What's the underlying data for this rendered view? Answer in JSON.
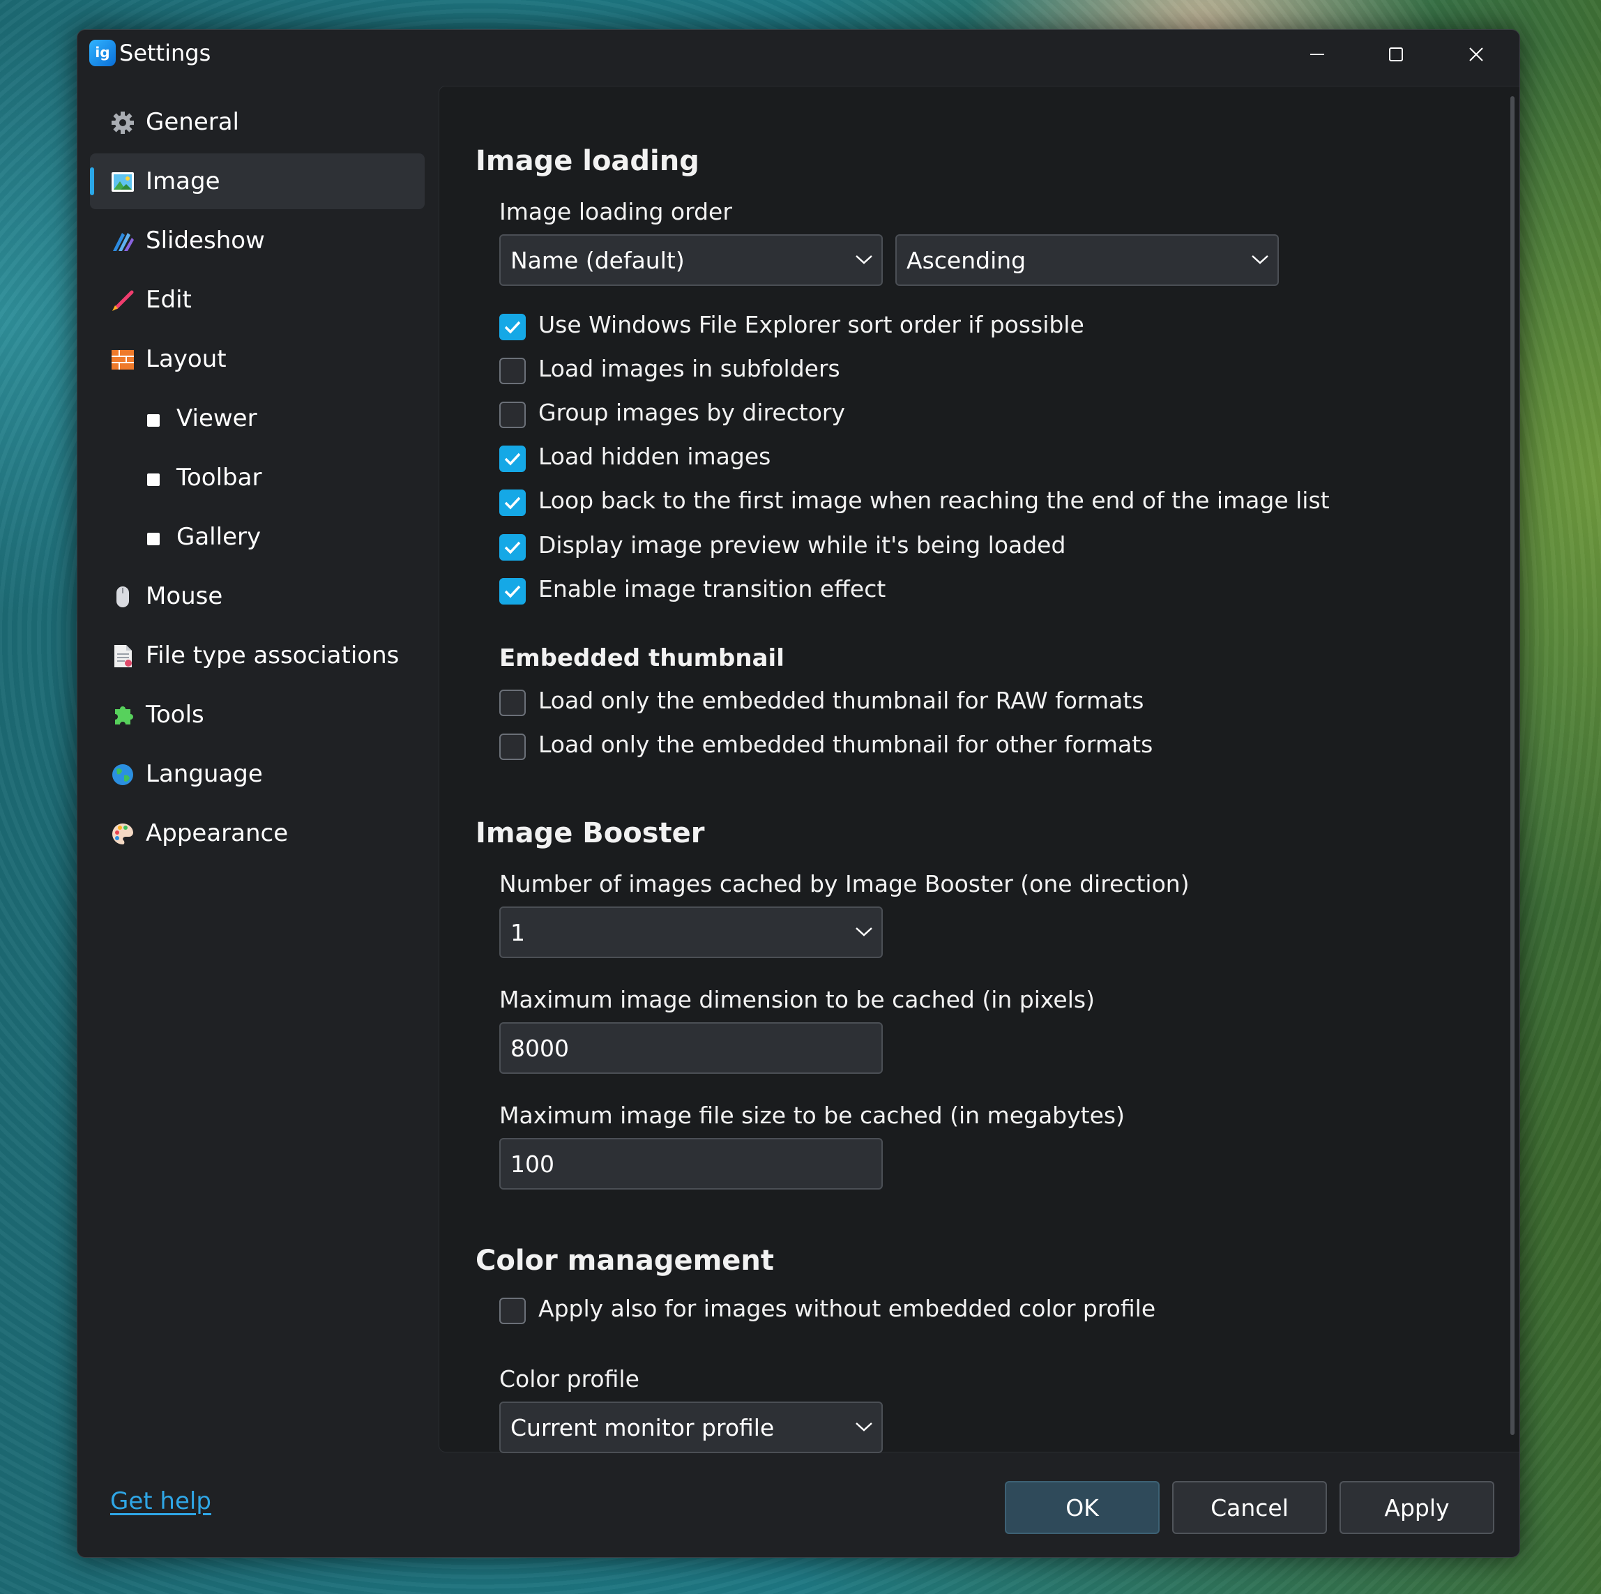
{
  "window": {
    "title": "Settings",
    "app_icon_text": "ig",
    "controls": {
      "minimize": "minimize-icon",
      "maximize": "maximize-icon",
      "close": "close-icon"
    }
  },
  "sidebar": {
    "items": [
      {
        "label": "General",
        "icon": "gear-icon"
      },
      {
        "label": "Image",
        "icon": "image-icon",
        "selected": true
      },
      {
        "label": "Slideshow",
        "icon": "slideshow-icon"
      },
      {
        "label": "Edit",
        "icon": "brush-icon"
      },
      {
        "label": "Layout",
        "icon": "layout-icon"
      },
      {
        "label": "Viewer",
        "sub": true
      },
      {
        "label": "Toolbar",
        "sub": true
      },
      {
        "label": "Gallery",
        "sub": true
      },
      {
        "label": "Mouse",
        "icon": "mouse-icon"
      },
      {
        "label": "File type associations",
        "icon": "file-icon"
      },
      {
        "label": "Tools",
        "icon": "puzzle-icon"
      },
      {
        "label": "Language",
        "icon": "globe-icon"
      },
      {
        "label": "Appearance",
        "icon": "palette-icon"
      }
    ],
    "help_link": "Get help"
  },
  "image_loading": {
    "heading": "Image loading",
    "order_label": "Image loading order",
    "order_value": "Name (default)",
    "direction_value": "Ascending",
    "options": [
      {
        "label": "Use Windows File Explorer sort order if possible",
        "checked": true
      },
      {
        "label": "Load images in subfolders",
        "checked": false
      },
      {
        "label": "Group images by directory",
        "checked": false
      },
      {
        "label": "Load hidden images",
        "checked": true
      },
      {
        "label": "Loop back to the first image when reaching the end of the image list",
        "checked": true
      },
      {
        "label": "Display image preview while it's being loaded",
        "checked": true
      },
      {
        "label": "Enable image transition effect",
        "checked": true
      }
    ]
  },
  "embedded_thumbnail": {
    "heading": "Embedded thumbnail",
    "options": [
      {
        "label": "Load only the embedded thumbnail for RAW formats",
        "checked": false
      },
      {
        "label": "Load only the embedded thumbnail for other formats",
        "checked": false
      }
    ]
  },
  "image_booster": {
    "heading": "Image Booster",
    "cache_count_label": "Number of images cached by Image Booster (one direction)",
    "cache_count_value": "1",
    "max_dimension_label": "Maximum image dimension to be cached (in pixels)",
    "max_dimension_value": "8000",
    "max_file_size_label": "Maximum image file size to be cached (in megabytes)",
    "max_file_size_value": "100"
  },
  "color_management": {
    "heading": "Color management",
    "apply_option": {
      "label": "Apply also for images without embedded color profile",
      "checked": false
    },
    "profile_label": "Color profile",
    "profile_value": "Current monitor profile"
  },
  "footer": {
    "ok": "OK",
    "cancel": "Cancel",
    "apply": "Apply"
  },
  "colors": {
    "accent": "#15a8e6",
    "window_bg": "#1f2124",
    "panel_bg": "#1a1c1e",
    "link": "#2fa6e6"
  }
}
